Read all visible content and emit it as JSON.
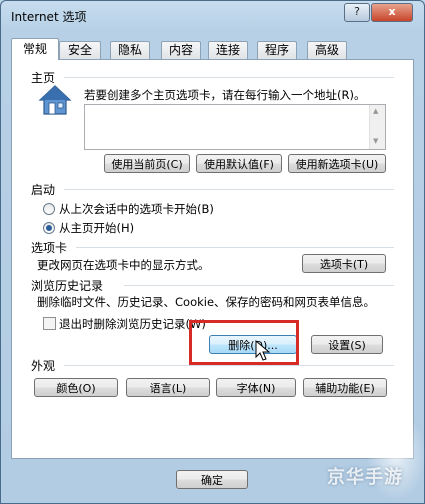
{
  "window": {
    "title": "Internet 选项",
    "help_label": "?",
    "close_label": "x"
  },
  "tabs": [
    {
      "label": "常规"
    },
    {
      "label": "安全"
    },
    {
      "label": "隐私"
    },
    {
      "label": "内容"
    },
    {
      "label": "连接"
    },
    {
      "label": "程序"
    },
    {
      "label": "高级"
    }
  ],
  "home": {
    "group_label": "主页",
    "instruction": "若要创建多个主页选项卡，请在每行输入一个地址(R)。",
    "url_value": "",
    "buttons": {
      "use_current": "使用当前页(C)",
      "use_default": "使用默认值(F)",
      "use_new_tab": "使用新选项卡(U)"
    }
  },
  "startup": {
    "group_label": "启动",
    "options": [
      {
        "label": "从上次会话中的选项卡开始(B)",
        "selected": false
      },
      {
        "label": "从主页开始(H)",
        "selected": true
      }
    ]
  },
  "tabs_section": {
    "group_label": "选项卡",
    "description": "更改网页在选项卡中的显示方式。",
    "button": "选项卡(T)"
  },
  "history": {
    "group_label": "浏览历史记录",
    "description": "删除临时文件、历史记录、Cookie、保存的密码和网页表单信息。",
    "checkbox_label": "退出时删除浏览历史记录(W)",
    "delete_button": "删除(D)...",
    "settings_button": "设置(S)"
  },
  "appearance": {
    "group_label": "外观",
    "buttons": {
      "colors": "颜色(O)",
      "languages": "语言(L)",
      "fonts": "字体(N)",
      "accessibility": "辅助功能(E)"
    }
  },
  "footer": {
    "ok_button": "确定"
  },
  "watermark": "京华手游",
  "colors": {
    "highlight": "#d72a24",
    "accent": "#2a5f9c"
  }
}
